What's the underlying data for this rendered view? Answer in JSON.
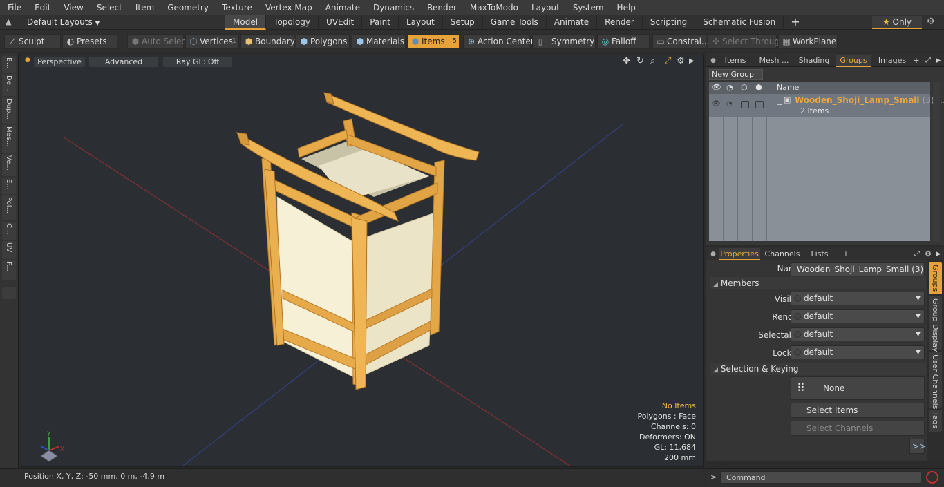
{
  "menu": [
    "File",
    "Edit",
    "View",
    "Select",
    "Item",
    "Geometry",
    "Texture",
    "Vertex Map",
    "Animate",
    "Dynamics",
    "Render",
    "MaxToModo",
    "Layout",
    "System",
    "Help"
  ],
  "layout_selector": "Default Layouts",
  "mode_tabs": [
    "Model",
    "Topology",
    "UVEdit",
    "Paint",
    "Layout",
    "Setup",
    "Game Tools",
    "Animate",
    "Render",
    "Scripting",
    "Schematic Fusion"
  ],
  "active_mode_tab": "Model",
  "only_label": "Only",
  "toolbar": {
    "sculpt": "Sculpt",
    "presets": "Presets",
    "auto_select": "Auto Select",
    "vertices": "Vertices",
    "vertices_count": "1",
    "boundary": "Boundary",
    "polygons": "Polygons",
    "materials": "Materials",
    "items": "Items",
    "items_count": "5",
    "action_center": "Action Center",
    "symmetry": "Symmetry",
    "falloff": "Falloff",
    "constraints": "Constrai...",
    "select_through": "Select Through",
    "workplane": "WorkPlane"
  },
  "left_tabs": [
    "B...",
    "De...",
    "Dup...",
    "Mes...",
    "Ve...",
    "E...",
    "Pol...",
    "C...",
    "UV",
    "F..."
  ],
  "viewport": {
    "perspective": "Perspective",
    "advanced": "Advanced",
    "raygl": "Ray GL: Off",
    "info": {
      "items": "No Items",
      "polygons": "Polygons : Face",
      "channels": "Channels: 0",
      "deformers": "Deformers: ON",
      "gl": "GL: 11,684",
      "scale": "200 mm"
    }
  },
  "status": {
    "position": "Position X, Y, Z:  -50 mm, 0 m, -4.9 m"
  },
  "right_tabs": [
    "Items",
    "Mesh ...",
    "Shading",
    "Groups",
    "Images"
  ],
  "active_right_tab": "Groups",
  "groups": {
    "new_group": "New Group",
    "column_name": "Name",
    "row": {
      "name": "Wooden_Shoji_Lamp_Small",
      "count": "(3)",
      "items": "2 Items"
    }
  },
  "props_tabs": [
    "Properties",
    "Channels",
    "Lists"
  ],
  "active_props_tab": "Properties",
  "properties": {
    "name_label": "Name",
    "name_value": "Wooden_Shoji_Lamp_Small (3)",
    "members_section": "Members",
    "visible_label": "Visible",
    "visible_value": "default",
    "render_label": "Render",
    "render_value": "default",
    "selectable_label": "Selectable",
    "selectable_value": "default",
    "locked_label": "Locked",
    "locked_value": "default",
    "selection_section": "Selection & Keying",
    "none_btn": "None",
    "select_items": "Select Items",
    "select_channels": "Select Channels",
    "more": ">>"
  },
  "side_tabs": [
    "Groups",
    "Group Display",
    "User Channels",
    "Tags"
  ],
  "command": {
    "placeholder": "Command"
  },
  "colors": {
    "accent": "#e8a23a",
    "group_name": "#f0a73c",
    "info_highlight": "#f0c040"
  }
}
